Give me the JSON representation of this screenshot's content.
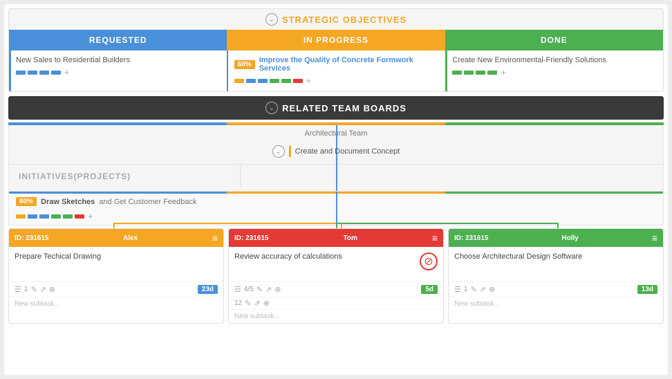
{
  "strategic_objectives": {
    "title": "STRATEGIC OBJECTIVES",
    "columns": [
      {
        "id": "requested",
        "label": "REQUESTED"
      },
      {
        "id": "in_progress",
        "label": "IN PROGRESS"
      },
      {
        "id": "done",
        "label": "DONE"
      }
    ],
    "cards": [
      {
        "col": "requested",
        "text": "New Sales to Residential Builders",
        "badge": null,
        "bar_color": "blue"
      },
      {
        "col": "in_progress",
        "text": "Improve the Quality of Concrete Formwork Services",
        "badge": "60%",
        "bar_color": "orange"
      },
      {
        "col": "done",
        "text": "Create New Environmental-Friendly Solutions",
        "badge": null,
        "bar_color": "green"
      }
    ],
    "dots_requested": [
      "blue",
      "blue",
      "blue",
      "blue"
    ],
    "dots_inprogress": [
      "orange",
      "blue",
      "blue",
      "green",
      "green",
      "red"
    ],
    "dots_done": [
      "green",
      "green",
      "green",
      "green"
    ]
  },
  "team_boards": {
    "title": "RELATED TEAM BOARDS",
    "team_name": "Architectural Team",
    "concept": {
      "text": "Create and Document Concept"
    }
  },
  "initiatives": {
    "title": "INITIATIVES(PROJECTS)"
  },
  "sketches": {
    "badge": "60%",
    "text_bold": "Draw Sketches",
    "text_rest": " and Get Customer Feedback",
    "dots": [
      "orange",
      "blue",
      "blue",
      "green",
      "green",
      "red"
    ]
  },
  "task_cards": [
    {
      "id": "ID: 231615",
      "assignee": "Alex",
      "color": "orange",
      "title": "Prepare Techical Drawing",
      "blocked": false,
      "meta_left": "☰",
      "meta_count": "1",
      "duration": "23d",
      "duration_color": "blue",
      "subtask_count": null
    },
    {
      "id": "ID: 231615",
      "assignee": "Tom",
      "color": "red",
      "title": "Review accuracy of calculations",
      "blocked": true,
      "meta_left": "☰",
      "meta_count": "4/5",
      "duration": "5d",
      "duration_color": "green",
      "subtask_count": "12"
    },
    {
      "id": "ID: 231615",
      "assignee": "Holly",
      "color": "green",
      "title": "Choose Architectural Design Software",
      "blocked": false,
      "meta_left": "☰",
      "meta_count": "1",
      "duration": "13d",
      "duration_color": "green",
      "subtask_count": null
    }
  ],
  "labels": {
    "new_subtask": "New subtask...",
    "plus": "+",
    "menu_icon": "≡",
    "chevron": "⌄",
    "blocked_icon": "⊘",
    "link_icon": "⇗",
    "attach_icon": "⊕",
    "edit_icon": "✎"
  }
}
